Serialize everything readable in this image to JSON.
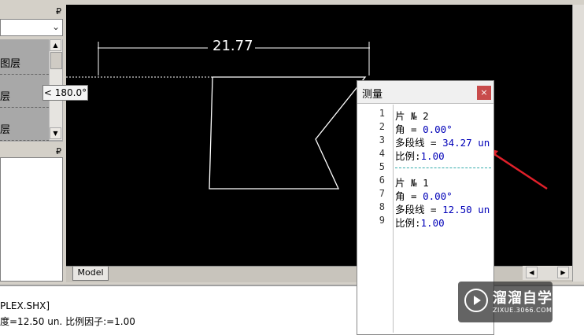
{
  "left_panel": {
    "layers": [
      "图层",
      "层",
      "层"
    ]
  },
  "canvas": {
    "dimension_text": "21.77",
    "model_tab": "Model",
    "window_controls": "▬ ▢ ✕"
  },
  "tooltip": {
    "angle": "< 180.0°"
  },
  "command_line": {
    "lines": [
      "PLEX.SHX]",
      "度=12.50 un. 比例因子:=1.00"
    ]
  },
  "measure_window": {
    "title": "测量",
    "close_label": "×",
    "line_numbers": [
      "1",
      "2",
      "3",
      "4",
      "5",
      "6",
      "7",
      "8",
      "9"
    ],
    "lines": [
      {
        "key": "片 № 2",
        "value": ""
      },
      {
        "key": "角 = ",
        "value": "0.00°"
      },
      {
        "key": "多段线 = ",
        "value": "34.27 un"
      },
      {
        "key": "比例:",
        "value": "1.00"
      },
      {
        "key": "",
        "value": ""
      },
      {
        "key": "片 № 1",
        "value": ""
      },
      {
        "key": "角 = ",
        "value": "0.00°"
      },
      {
        "key": "多段线 = ",
        "value": "12.50 un"
      },
      {
        "key": "比例:",
        "value": "1.00"
      }
    ]
  },
  "watermark": {
    "main": "溜溜自学",
    "sub": "ZIXUE.3066.COM"
  },
  "colors": {
    "canvas_bg": "#000000",
    "arrow": "#e0202a",
    "value_text": "#0000b8"
  }
}
